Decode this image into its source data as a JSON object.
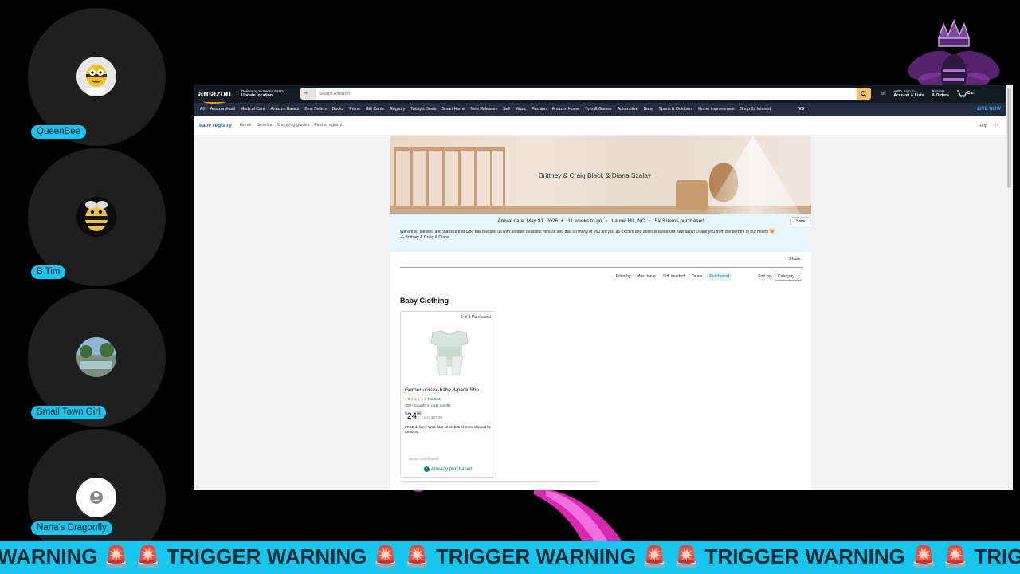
{
  "participants": [
    {
      "name": "QueenBee",
      "avatar": "bee-cartoon-avatar"
    },
    {
      "name": "B Tim",
      "avatar": "bee-mascot-avatar"
    },
    {
      "name": "Small Town Girl",
      "avatar": "landscape-photo-avatar"
    },
    {
      "name": "Nana's Dragonfly",
      "avatar": "default-user-icon"
    }
  ],
  "amazon": {
    "logo": "amazon",
    "deliver_line1": "Delivering to Peoria 61604",
    "deliver_line2": "Update location",
    "search_category": "All",
    "search_placeholder": "Search Amazon",
    "lang": "EN",
    "account_line1": "Hello, sign in",
    "account_line2": "Account & Lists",
    "returns_line1": "Returns",
    "returns_line2": "& Orders",
    "cart": "Cart",
    "nav": [
      "All",
      "Amazon Haul",
      "Medical Care",
      "Amazon Basics",
      "Best Sellers",
      "Books",
      "Prime",
      "Gift Cards",
      "Registry",
      "Today's Deals",
      "Smart Home",
      "New Releases",
      "Sell",
      "Music",
      "Fashion",
      "Amazon Home",
      "Toys & Games",
      "Automotive",
      "Baby",
      "Sports & Outdoors",
      "Home Improvement",
      "Shop By Interest"
    ],
    "nav_vs": "VS",
    "nav_live": "LIVE NOW",
    "subnav": {
      "brand": "baby registry",
      "items": [
        "Home",
        "Benefits",
        "Shopping guides",
        "Find a registry"
      ],
      "help": "Help"
    }
  },
  "registry": {
    "names": "Brittney & Craig Black & Diana Szalay",
    "arrival": "Arrival date: May 31, 2026",
    "weeks": "11 weeks to go",
    "location": "Laurel Hill, NC",
    "purchased": "5/43 items purchased",
    "save": "Save",
    "message": "We are so blessed and thankful that God has blessed us with another beautiful miracle and that so many of you are just as excited and anxious about our new baby! Thank you from the bottom of our hearts",
    "signature": "— Brittney & Craig & Diana",
    "share": "Share",
    "filter_label": "Filter by:",
    "filters": [
      "Must have",
      "Still needed",
      "Deals",
      "Purchased"
    ],
    "sort_label": "Sort by:",
    "sort_value": "Category"
  },
  "section_title": "Baby Clothing",
  "product": {
    "count": "1 of 1 Purchased",
    "title": "Gerber unisex-baby 8-pack Sho...",
    "rating": "4.2",
    "stars": "★★★★★",
    "reviews": "(58,053)",
    "bought": "200+ bought in past month",
    "price_whole": "24",
    "price_frac": "99",
    "list_price": "List: $27.99",
    "shipping": "FREE delivery Wed, Mar 18 on $35 of items shipped by Amazon",
    "contributed": "$0.00 contributed",
    "status": "Already purchased"
  },
  "ticker": "WARNING 🚨 🚨 TRIGGER WARNING 🚨 🚨 TRIGGER WARNING 🚨 🚨 TRIGGER WARNING 🚨 🚨 TRIGGER W"
}
